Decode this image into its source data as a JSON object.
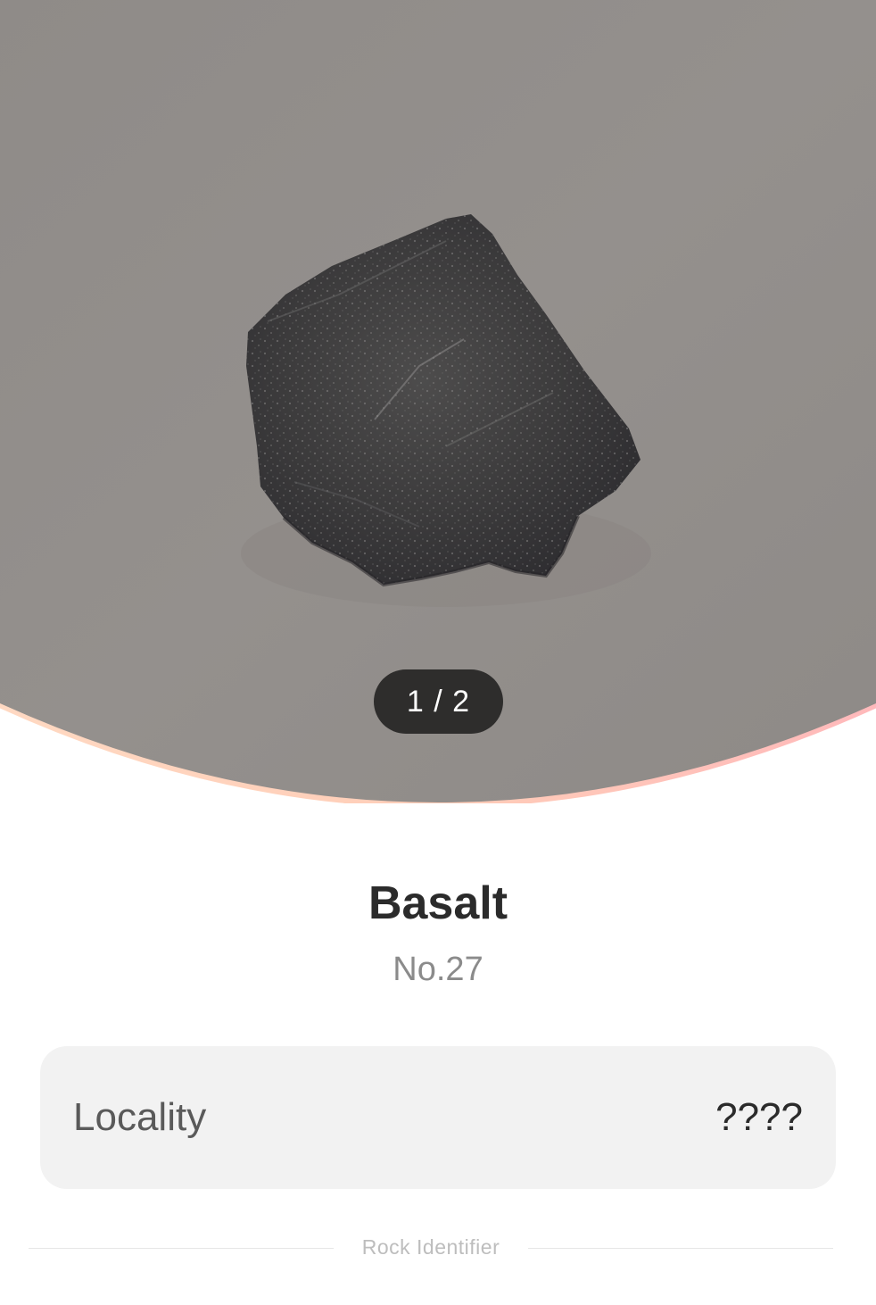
{
  "gallery": {
    "counter": "1 / 2",
    "image_subject": "rock-specimen-photo",
    "arc_gradient": [
      "#ffd3bd",
      "#ffbfbf"
    ]
  },
  "specimen": {
    "name": "Basalt",
    "number": "No.27"
  },
  "details": {
    "locality_label": "Locality",
    "locality_value": "????"
  },
  "footer": {
    "brand": "Rock Identifier"
  },
  "colors": {
    "photo_background": "#908c89",
    "counter_pill": "#2e2d2c",
    "card_background": "#f2f2f2"
  }
}
